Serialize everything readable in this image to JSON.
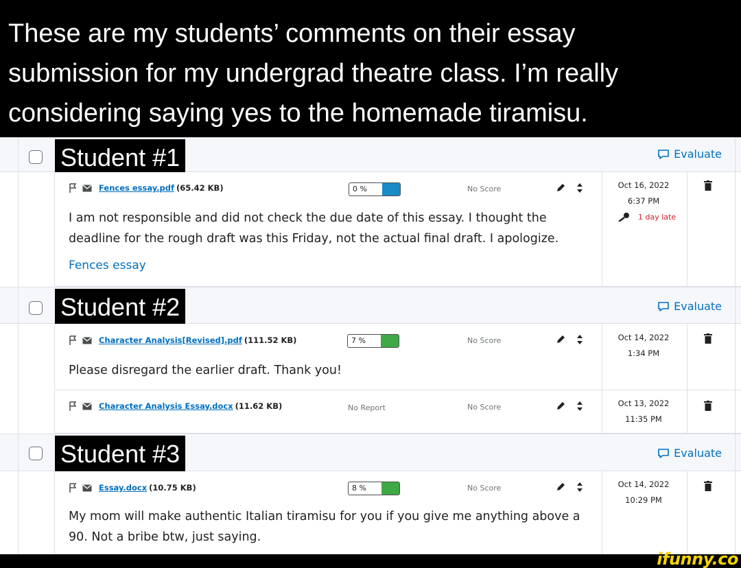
{
  "caption": {
    "line1": "These are my students’ comments on their essay",
    "line2": "submission for my undergrad theatre class. I’m really",
    "line3": "considering saying yes to the homemade tiramisu."
  },
  "evaluate_label": "Evaluate",
  "no_score_label": "No Score",
  "no_report_label": "No Report",
  "students": [
    {
      "name": "Student #1",
      "submissions": [
        {
          "file_name": "Fences essay.pdf",
          "file_size": "(65.42 KB)",
          "similarity": "0 %",
          "similarity_value": 0,
          "similarity_color": "#1a8bc6",
          "date": "Oct 16, 2022",
          "time": "6:37 PM",
          "late": "1 day late",
          "comment": "I am not responsible and did not check the due date of this essay. I thought the deadline for the rough draft was this Friday, not the actual final draft. I apologize.",
          "assignment_link": "Fences essay"
        }
      ]
    },
    {
      "name": "Student #2",
      "submissions": [
        {
          "file_name": "Character Analysis[Revised].pdf",
          "file_size": "(111.52 KB)",
          "similarity": "7 %",
          "similarity_value": 7,
          "similarity_color": "#3fa845",
          "date": "Oct 14, 2022",
          "time": "1:34 PM",
          "comment": "Please disregard the earlier draft. Thank you!"
        },
        {
          "file_name": "Character Analysis Essay.docx",
          "file_size": "(11.62 KB)",
          "date": "Oct 13, 2022",
          "time": "11:35 PM"
        }
      ]
    },
    {
      "name": "Student #3",
      "submissions": [
        {
          "file_name": "Essay.docx",
          "file_size": "(10.75 KB)",
          "similarity": "8 %",
          "similarity_value": 8,
          "similarity_color": "#3fa845",
          "date": "Oct 14, 2022",
          "time": "10:29 PM",
          "comment": "My mom will make authentic Italian tiramisu for you if you give me anything above a 90. Not a bribe btw, just saying."
        }
      ]
    }
  ],
  "watermark": "ifunny.co"
}
